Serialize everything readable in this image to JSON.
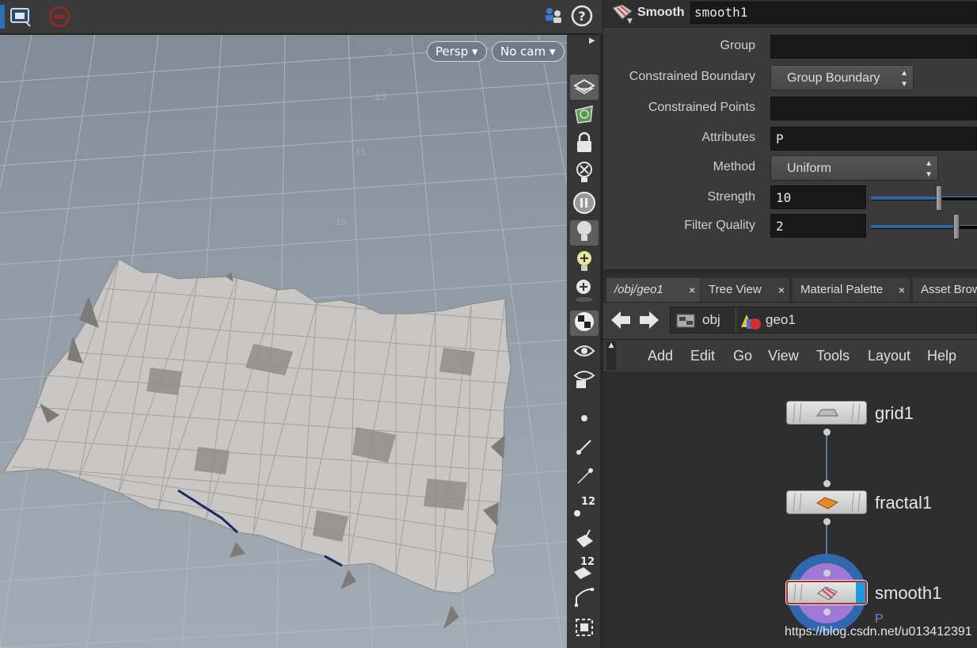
{
  "viewport": {
    "persp_label": "Persp",
    "cam_label": "No cam",
    "tool_badge_1": "12",
    "tool_badge_2": "12"
  },
  "param": {
    "node_type": "Smooth",
    "node_name": "smooth1",
    "rows": {
      "group": {
        "label": "Group",
        "value": ""
      },
      "constrained_boundary": {
        "label": "Constrained Boundary",
        "value": "Group Boundary"
      },
      "constrained_points": {
        "label": "Constrained Points",
        "value": ""
      },
      "attributes": {
        "label": "Attributes",
        "value": "P"
      },
      "method": {
        "label": "Method",
        "value": "Uniform"
      },
      "strength": {
        "label": "Strength",
        "value": "10"
      },
      "filter_quality": {
        "label": "Filter Quality",
        "value": "2"
      }
    }
  },
  "network": {
    "tabs": [
      {
        "label": "/obj/geo1",
        "close": "×"
      },
      {
        "label": "Tree View",
        "close": "×"
      },
      {
        "label": "Material Palette",
        "close": "×"
      },
      {
        "label": "Asset Brow"
      }
    ],
    "path": [
      "obj",
      "geo1"
    ],
    "menu": [
      "Add",
      "Edit",
      "Go",
      "View",
      "Tools",
      "Layout",
      "Help"
    ],
    "nodes": [
      {
        "name": "grid1"
      },
      {
        "name": "fractal1"
      },
      {
        "name": "smooth1",
        "flag": "P"
      }
    ]
  },
  "watermark": "https://blog.csdn.net/u013412391",
  "colors": {
    "viewport_bg": "#8f9aa4",
    "mesh": "#c9c7c6",
    "accent": "#2f67a2",
    "display_flag": "#1e9be0"
  }
}
